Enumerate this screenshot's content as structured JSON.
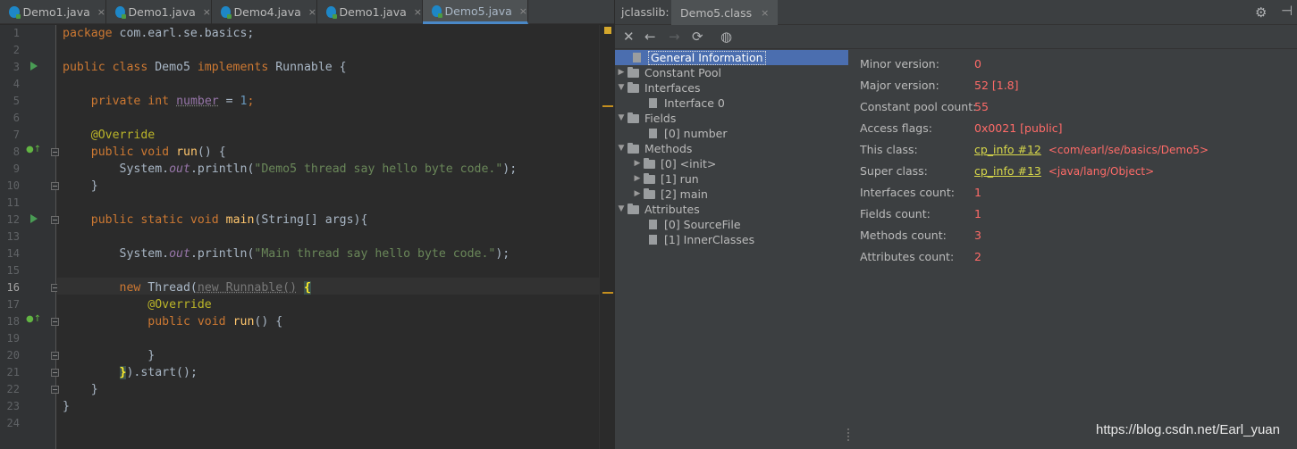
{
  "editor": {
    "tabs": [
      {
        "label": "Demo1.java",
        "active": false
      },
      {
        "label": "Demo1.java",
        "active": false
      },
      {
        "label": "Demo4.java",
        "active": false
      },
      {
        "label": "Demo1.java",
        "active": false
      },
      {
        "label": "Demo5.java",
        "active": true
      }
    ],
    "close_glyph": "×",
    "line_numbers": [
      "1",
      "2",
      "3",
      "4",
      "5",
      "6",
      "7",
      "8",
      "9",
      "10",
      "11",
      "12",
      "13",
      "14",
      "15",
      "16",
      "17",
      "18",
      "19",
      "20",
      "21",
      "22",
      "23",
      "24"
    ],
    "current_line": "16",
    "code": {
      "l1": {
        "kw": "package",
        "rest": " com.earl.se.basics;"
      },
      "l3": {
        "kw1": "public class",
        "name": " Demo5 ",
        "kw2": "implements",
        "rest": " Runnable {"
      },
      "l5": {
        "kw": "private int",
        "sp": " ",
        "field": "number",
        "eq": " = ",
        "num": "1",
        "end": ";"
      },
      "l7": {
        "ann": "@Override"
      },
      "l8": {
        "kw": "public void",
        "sp": " ",
        "fn": "run",
        "rest": "() {"
      },
      "l9": {
        "a": "System.",
        "out": "out",
        "b": ".println(",
        "str": "\"Demo5 thread say hello byte code.\"",
        "c": ");"
      },
      "l10": {
        "text": "}"
      },
      "l12": {
        "kw": "public static void",
        "sp": " ",
        "fn": "main",
        "rest": "(String[] args){"
      },
      "l14": {
        "a": "System.",
        "out": "out",
        "b": ".println(",
        "str": "\"Main thread say hello byte code.\"",
        "c": ");"
      },
      "l16": {
        "kw": "new",
        "a": " Thread(",
        "b": "new Runnable()",
        "c": " ",
        "brace": "{"
      },
      "l17": {
        "ann": "@Override"
      },
      "l18": {
        "kw": "public void",
        "sp": " ",
        "fn": "run",
        "rest": "() {"
      },
      "l20": {
        "text": "}"
      },
      "l21": {
        "brace": "}",
        "rest": ").start();"
      },
      "l22": {
        "text": "}"
      },
      "l23": {
        "text": "}"
      }
    }
  },
  "jclasslib": {
    "title": "jclasslib:",
    "tab": "Demo5.class",
    "gear_icon": "⚙",
    "toolbar": [
      "close-icon",
      "back-icon",
      "forward-icon",
      "reload-icon",
      "browser-icon"
    ],
    "tree": [
      {
        "label": "General Information",
        "type": "doc",
        "depth": 1,
        "selected": true
      },
      {
        "label": "Constant Pool",
        "type": "folder",
        "depth": 0,
        "arrow": "collapsed"
      },
      {
        "label": "Interfaces",
        "type": "folder",
        "depth": 0,
        "arrow": "expanded"
      },
      {
        "label": "Interface 0",
        "type": "doc",
        "depth": 2
      },
      {
        "label": "Fields",
        "type": "folder",
        "depth": 0,
        "arrow": "expanded"
      },
      {
        "label": "[0] number",
        "type": "doc",
        "depth": 2
      },
      {
        "label": "Methods",
        "type": "folder",
        "depth": 0,
        "arrow": "expanded"
      },
      {
        "label": "[0] <init>",
        "type": "folder",
        "depth": 1,
        "arrow": "collapsed"
      },
      {
        "label": "[1] run",
        "type": "folder",
        "depth": 1,
        "arrow": "collapsed"
      },
      {
        "label": "[2] main",
        "type": "folder",
        "depth": 1,
        "arrow": "collapsed"
      },
      {
        "label": "Attributes",
        "type": "folder",
        "depth": 0,
        "arrow": "expanded"
      },
      {
        "label": "[0] SourceFile",
        "type": "doc",
        "depth": 2
      },
      {
        "label": "[1] InnerClasses",
        "type": "doc",
        "depth": 2
      }
    ],
    "details": [
      {
        "key": "Minor version:",
        "value": "0"
      },
      {
        "key": "Major version:",
        "value": "52 [1.8]"
      },
      {
        "key": "Constant pool count:",
        "value": "55"
      },
      {
        "key": "Access flags:",
        "value": "0x0021 [public]"
      },
      {
        "key": "This class:",
        "link": "cp_info #12",
        "comment": "<com/earl/se/basics/Demo5>"
      },
      {
        "key": "Super class:",
        "link": "cp_info #13",
        "comment": "<java/lang/Object>"
      },
      {
        "key": "Interfaces count:",
        "value": "1"
      },
      {
        "key": "Fields count:",
        "value": "1"
      },
      {
        "key": "Methods count:",
        "value": "3"
      },
      {
        "key": "Attributes count:",
        "value": "2"
      }
    ]
  },
  "watermark": "https://blog.csdn.net/Earl_yuan"
}
